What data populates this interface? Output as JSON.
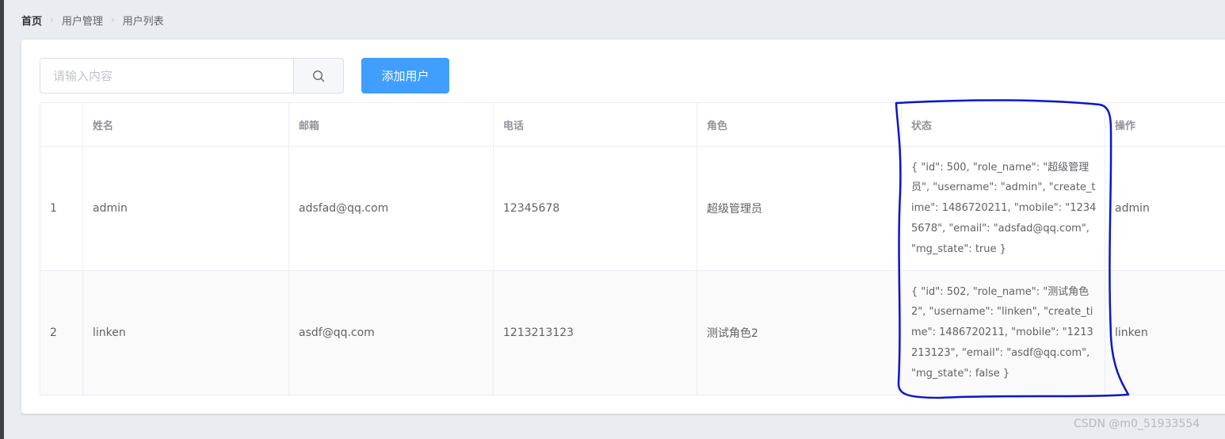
{
  "breadcrumb": {
    "home": "首页",
    "section": "用户管理",
    "page": "用户列表"
  },
  "toolbar": {
    "search_placeholder": "请输入内容",
    "search_value": "",
    "add_label": "添加用户"
  },
  "table": {
    "headers": {
      "index": "",
      "name": "姓名",
      "email": "邮箱",
      "phone": "电话",
      "role": "角色",
      "state": "状态",
      "actions": "操作"
    },
    "rows": [
      {
        "index": "1",
        "name": "admin",
        "email": "adsfad@qq.com",
        "phone": "12345678",
        "role": "超级管理员",
        "state": "{ \"id\": 500, \"role_name\": \"超级管理员\", \"username\": \"admin\", \"create_time\": 1486720211, \"mobile\": \"12345678\", \"email\": \"adsfad@qq.com\", \"mg_state\": true }",
        "action": "admin"
      },
      {
        "index": "2",
        "name": "linken",
        "email": "asdf@qq.com",
        "phone": "1213213123",
        "role": "测试角色2",
        "state": "{ \"id\": 502, \"role_name\": \"测试角色2\", \"username\": \"linken\", \"create_time\": 1486720211, \"mobile\": \"1213213123\", \"email\": \"asdf@qq.com\", \"mg_state\": false }",
        "action": "linken"
      }
    ]
  },
  "watermark": "CSDN @m0_51933554",
  "colors": {
    "primary": "#409eff",
    "annotation": "#0b16c9",
    "background": "#e9ecf0"
  },
  "icons": {
    "search": "search-icon",
    "separator": "chevron-right-icon"
  }
}
